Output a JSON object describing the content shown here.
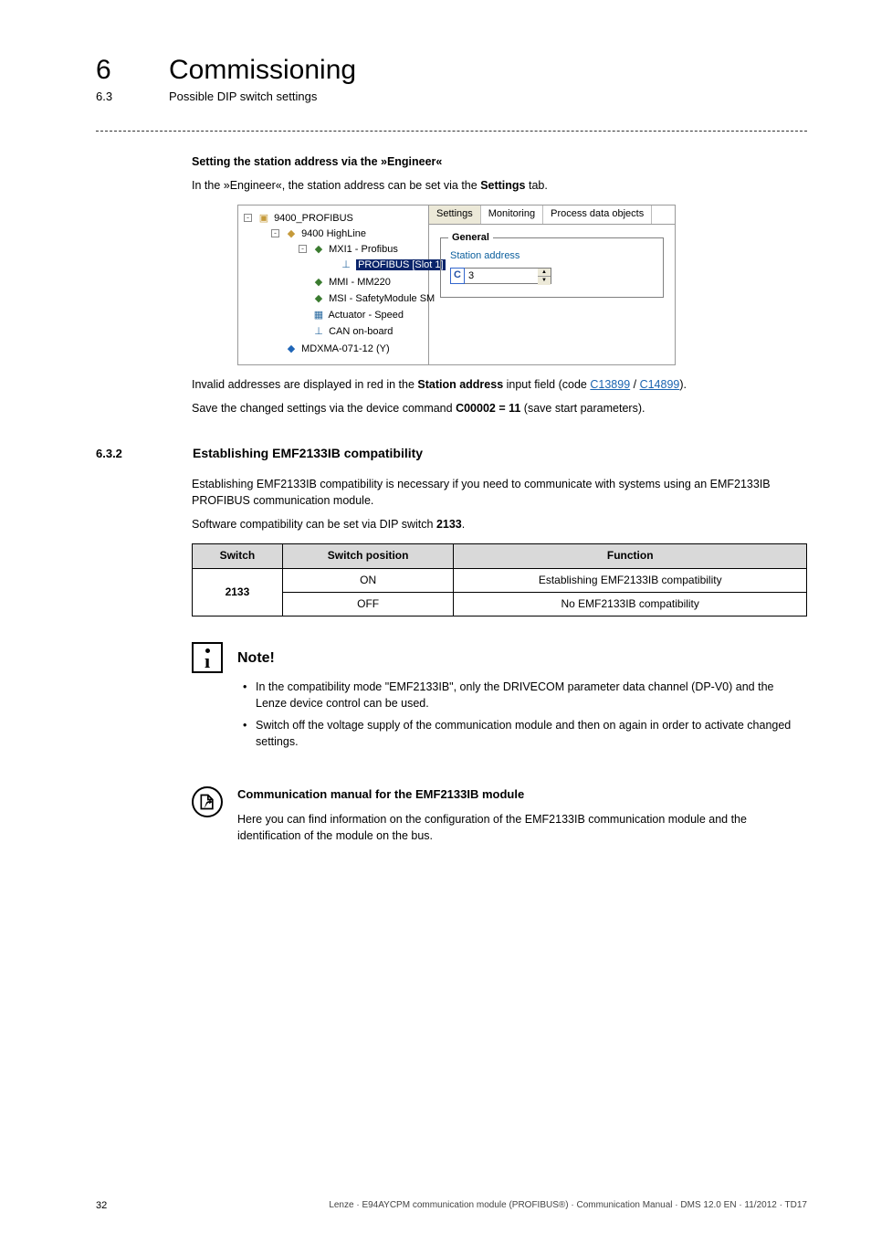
{
  "header": {
    "chapter_number": "6",
    "chapter_title": "Commissioning",
    "section_number": "6.3",
    "section_title": "Possible DIP switch settings"
  },
  "intro": {
    "heading": "Setting the station address via the »Engineer«",
    "line1_pre": "In the »Engineer«, the station address can be set via the ",
    "line1_bold": "Settings",
    "line1_post": " tab."
  },
  "screenshot": {
    "tree": {
      "root": "9400_PROFIBUS",
      "node1": "9400 HighLine",
      "node2": "MXI1 - Profibus",
      "node2_sel": "PROFIBUS [Slot 1]",
      "node3": "MMI - MM220",
      "node4": "MSI - SafetyModule SM",
      "node5": "Actuator - Speed",
      "node6": "CAN on-board",
      "node7": "MDXMA-071-12 (Y)"
    },
    "tabs": {
      "t1": "Settings",
      "t2": "Monitoring",
      "t3": "Process data objects"
    },
    "panel": {
      "group": "General",
      "label": "Station address",
      "c_sym": "C",
      "value": "3"
    }
  },
  "after_shot": {
    "p1_pre": "Invalid addresses are displayed in red in the ",
    "p1_bold": "Station address",
    "p1_mid": " input field (code ",
    "p1_link1": "C13899",
    "p1_sep": " / ",
    "p1_link2": "C14899",
    "p1_post": ").",
    "p2_pre": "Save the changed settings via the device command ",
    "p2_bold": "C00002 = 11",
    "p2_post": " (save start parameters)."
  },
  "section632": {
    "num": "6.3.2",
    "title": "Establishing EMF2133IB compatibility",
    "para1": "Establishing EMF2133IB compatibility is necessary if you need to communicate with systems using an EMF2133IB PROFIBUS communication module.",
    "para2_pre": "Software compatibility can be set via DIP switch ",
    "para2_bold": "2133",
    "para2_post": "."
  },
  "table": {
    "h1": "Switch",
    "h2": "Switch position",
    "h3": "Function",
    "r1c1": "2133",
    "r1c2": "ON",
    "r1c3": "Establishing EMF2133IB compatibility",
    "r2c2": "OFF",
    "r2c3": "No EMF2133IB compatibility"
  },
  "note": {
    "title": "Note!",
    "b1": "In the compatibility mode \"EMF2133IB\", only the DRIVECOM parameter data channel (DP-V0) and the Lenze device control can be used.",
    "b2": "Switch off the voltage supply of the communication module and then on again in order to activate changed settings."
  },
  "manual": {
    "title": "Communication manual for the EMF2133IB module",
    "body": "Here you can find information on the configuration of the EMF2133IB communication module and the identification of the module on the bus."
  },
  "footer": {
    "page": "32",
    "line": "Lenze · E94AYCPM communication module (PROFIBUS®) · Communication Manual · DMS 12.0 EN · 11/2012 · TD17"
  }
}
